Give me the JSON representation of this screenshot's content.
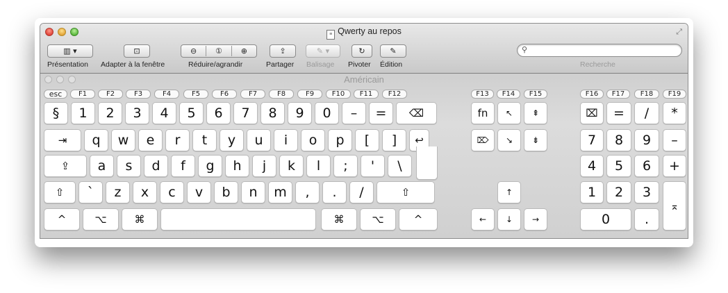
{
  "window": {
    "title": "Qwerty au repos",
    "doc_icon": "document-icon",
    "fullscreen_icon": "fullscreen-icon"
  },
  "toolbar": {
    "presentation_label": "Présentation",
    "adapter_label": "Adapter à la fenêtre",
    "zoom_label": "Réduire/agrandir",
    "share_label": "Partager",
    "balisage_label": "Balisage",
    "pivot_label": "Pivoter",
    "edition_label": "Édition",
    "search_label": "Recherche",
    "search_value": ""
  },
  "keyboard": {
    "title": "Américain",
    "fkeys": [
      "esc",
      "F1",
      "F2",
      "F3",
      "F4",
      "F5",
      "F6",
      "F7",
      "F8",
      "F9",
      "F10",
      "F11",
      "F12",
      "F13",
      "F14",
      "F15",
      "F16",
      "F17",
      "F18",
      "F19"
    ],
    "row1": [
      "§",
      "1",
      "2",
      "3",
      "4",
      "5",
      "6",
      "7",
      "8",
      "9",
      "0",
      "–",
      "=",
      "⌫"
    ],
    "row2": [
      "⇥",
      "q",
      "w",
      "e",
      "r",
      "t",
      "y",
      "u",
      "i",
      "o",
      "p",
      "[",
      "]",
      "↩"
    ],
    "row3": [
      "⇪",
      "a",
      "s",
      "d",
      "f",
      "g",
      "h",
      "j",
      "k",
      "l",
      ";",
      "'",
      "\\"
    ],
    "row4": [
      "⇧",
      "`",
      "z",
      "x",
      "c",
      "v",
      "b",
      "n",
      "m",
      ",",
      ".",
      "/",
      "⇧"
    ],
    "row5": [
      "^",
      "⌥",
      "⌘",
      "",
      "⌘",
      "⌥",
      "^"
    ],
    "nav": [
      "fn",
      "↖",
      "⇞",
      "⌦",
      "↘",
      "⇟",
      "↑",
      "←",
      "↓",
      "→"
    ],
    "numpad": [
      "⌧",
      "=",
      "/",
      "*",
      "7",
      "8",
      "9",
      "–",
      "4",
      "5",
      "6",
      "+",
      "1",
      "2",
      "3",
      "⌅",
      "0",
      "."
    ]
  }
}
